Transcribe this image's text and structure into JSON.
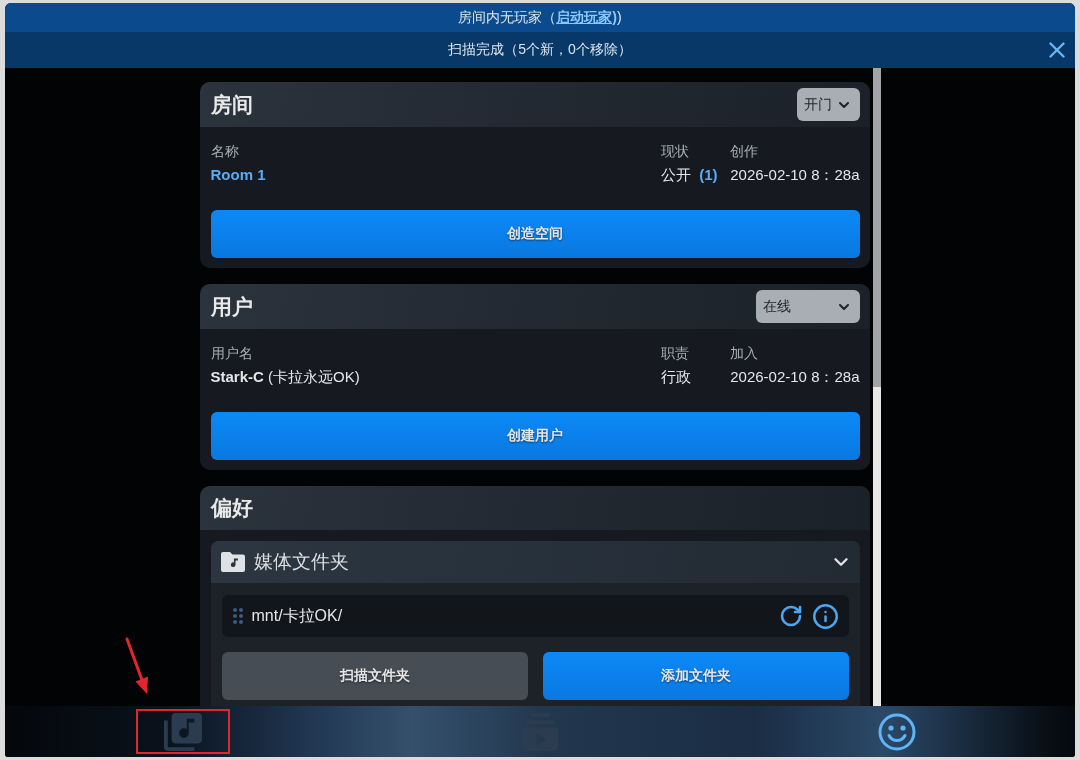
{
  "notice": {
    "text": "房间内无玩家（",
    "link": "启动玩家)",
    "suffix": ")"
  },
  "status_bar": {
    "text": "扫描完成（5个新，0个移除）"
  },
  "room": {
    "title": "房间",
    "dropdown": {
      "kind": "menu",
      "label": "开门"
    },
    "fields": [
      {
        "kind": "link",
        "label": "名称",
        "value": "Room 1"
      },
      {
        "kind": "count",
        "label": "现状",
        "value": "公开",
        "count": "(1)"
      },
      {
        "kind": "text",
        "label": "创作",
        "value": "2026-02-10 8：28a"
      }
    ],
    "button": "创造空间"
  },
  "users": {
    "title": "用户",
    "dropdown": {
      "kind": "select",
      "label": "在线"
    },
    "fields": [
      {
        "kind": "rich",
        "label": "用户名",
        "value": "**Stark-C** (卡拉永远OK)"
      },
      {
        "kind": "text",
        "label": "职责",
        "value": "行政"
      },
      {
        "kind": "text",
        "label": "加入",
        "value": "2026-02-10 8：28a"
      }
    ],
    "button": "创建用户"
  },
  "preferences": {
    "title": "偏好",
    "section": {
      "title": "媒体文件夹",
      "expanded": true,
      "folders": [
        {
          "path": "mnt/卡拉OK/"
        }
      ],
      "buttons": [
        {
          "kind": "secondary",
          "label": "扫描文件夹"
        },
        {
          "kind": "primary",
          "label": "添加文件夹"
        }
      ]
    }
  },
  "nav": [
    {
      "kind": "library",
      "selected": false,
      "annotated": true
    },
    {
      "kind": "queue",
      "selected": false,
      "annotated": false
    },
    {
      "kind": "profile",
      "selected": true,
      "annotated": false
    }
  ]
}
